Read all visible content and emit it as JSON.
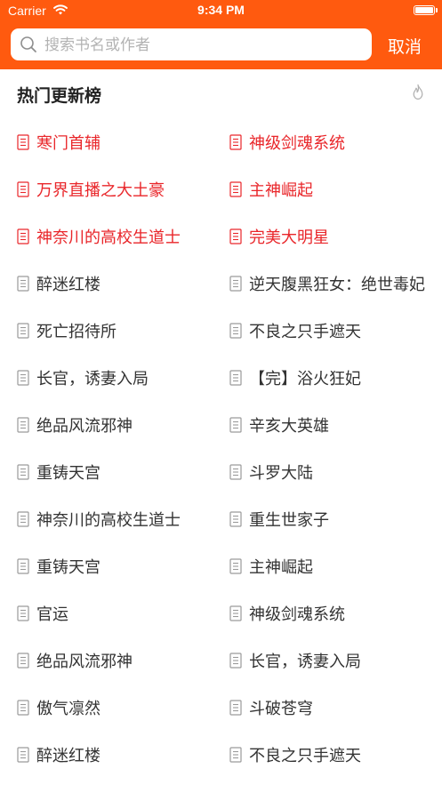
{
  "status_bar": {
    "carrier": "Carrier",
    "time": "9:34 PM"
  },
  "search": {
    "placeholder": "搜索书名或作者",
    "value": "",
    "cancel_label": "取消"
  },
  "section": {
    "title": "热门更新榜"
  },
  "colors": {
    "accent": "#FF5A0F",
    "hot_text": "#E9262A",
    "normal_text": "#333333",
    "icon_gray": "#9a9a9a"
  },
  "books": [
    {
      "title": "寒门首辅",
      "hot": true
    },
    {
      "title": "神级剑魂系统",
      "hot": true
    },
    {
      "title": "万界直播之大土豪",
      "hot": true
    },
    {
      "title": "主神崛起",
      "hot": true
    },
    {
      "title": "神奈川的高校生道士",
      "hot": true
    },
    {
      "title": "完美大明星",
      "hot": true
    },
    {
      "title": "醉迷红楼",
      "hot": false
    },
    {
      "title": "逆天腹黑狂女：绝世毒妃",
      "hot": false
    },
    {
      "title": "死亡招待所",
      "hot": false
    },
    {
      "title": "不良之只手遮天",
      "hot": false
    },
    {
      "title": "长官，诱妻入局",
      "hot": false
    },
    {
      "title": "【完】浴火狂妃",
      "hot": false
    },
    {
      "title": "绝品风流邪神",
      "hot": false
    },
    {
      "title": "辛亥大英雄",
      "hot": false
    },
    {
      "title": "重铸天宫",
      "hot": false
    },
    {
      "title": "斗罗大陆",
      "hot": false
    },
    {
      "title": "神奈川的高校生道士",
      "hot": false
    },
    {
      "title": "重生世家子",
      "hot": false
    },
    {
      "title": "重铸天宫",
      "hot": false
    },
    {
      "title": "主神崛起",
      "hot": false
    },
    {
      "title": "官运",
      "hot": false
    },
    {
      "title": "神级剑魂系统",
      "hot": false
    },
    {
      "title": "绝品风流邪神",
      "hot": false
    },
    {
      "title": "长官，诱妻入局",
      "hot": false
    },
    {
      "title": "傲气凛然",
      "hot": false
    },
    {
      "title": "斗破苍穹",
      "hot": false
    },
    {
      "title": "醉迷红楼",
      "hot": false
    },
    {
      "title": "不良之只手遮天",
      "hot": false
    }
  ]
}
